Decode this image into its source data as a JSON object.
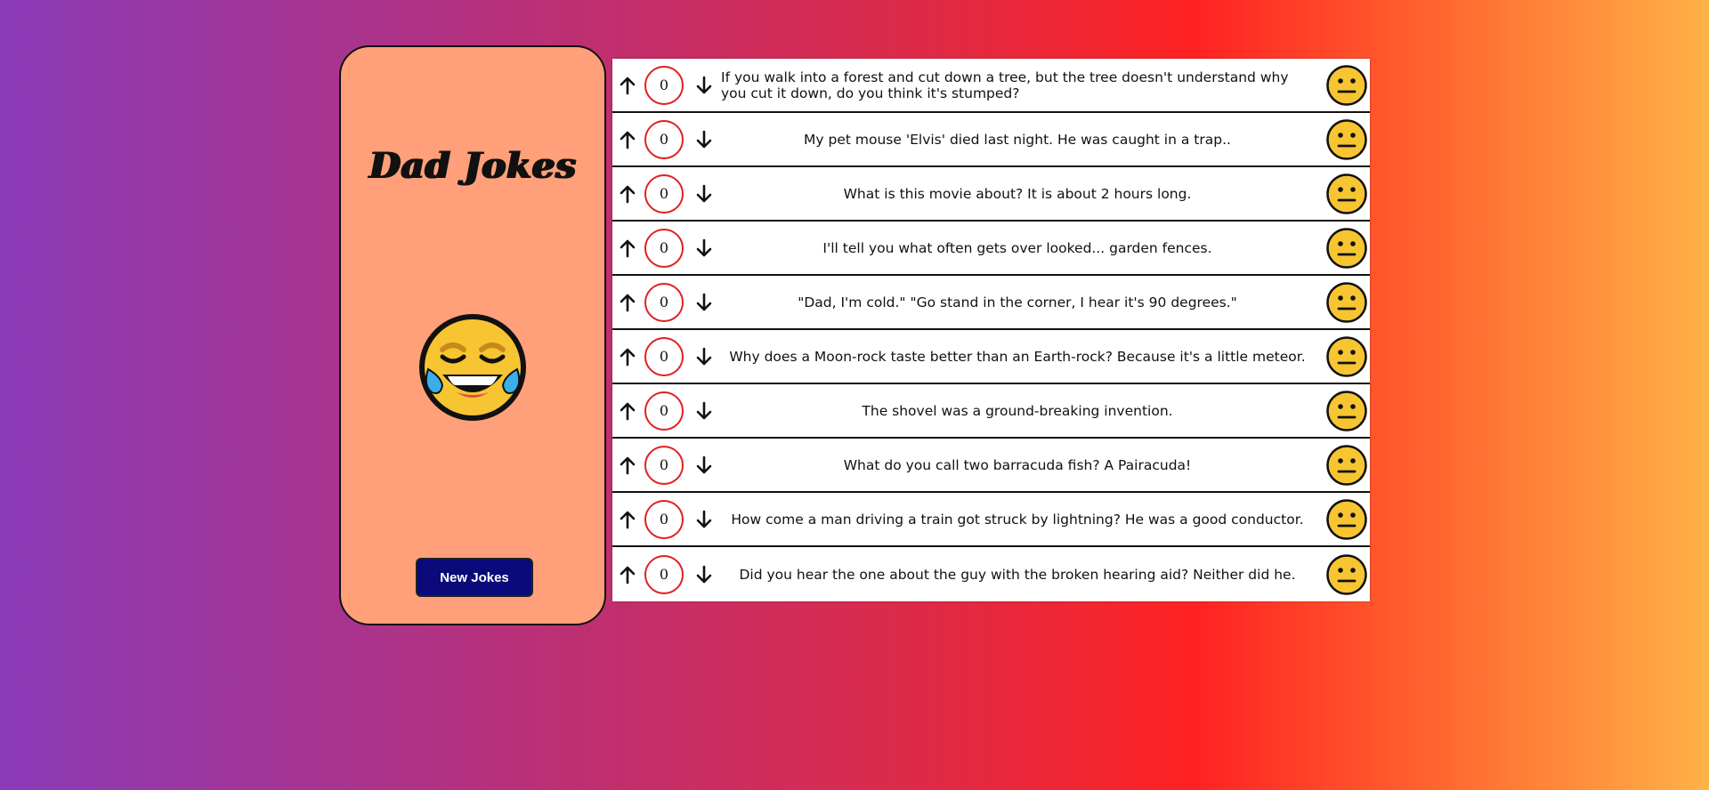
{
  "app": {
    "title": "Dad Jokes",
    "new_jokes_label": "New Jokes"
  },
  "icons": {
    "header_emoji": "laughing-tears-emoji-icon",
    "joke_emoji": "neutral-face-emoji-icon",
    "upvote": "arrow-up-icon",
    "downvote": "arrow-down-icon"
  },
  "colors": {
    "sidebar_bg": "#ffa07a",
    "button_bg": "#0a0a7a",
    "score_border": "#e02020"
  },
  "jokes": [
    {
      "score": "0",
      "text": "If you walk into a forest and cut down a tree, but the tree doesn't understand why you cut it down, do you think it's stumped?"
    },
    {
      "score": "0",
      "text": "My pet mouse 'Elvis' died last night. He was caught in a trap.."
    },
    {
      "score": "0",
      "text": "What is this movie about? It is about 2 hours long."
    },
    {
      "score": "0",
      "text": "I'll tell you what often gets over looked... garden fences."
    },
    {
      "score": "0",
      "text": "\"Dad, I'm cold.\" \"Go stand in the corner, I hear it's 90 degrees.\""
    },
    {
      "score": "0",
      "text": "Why does a Moon-rock taste better than an Earth-rock? Because it's a little meteor."
    },
    {
      "score": "0",
      "text": "The shovel was a ground-breaking invention."
    },
    {
      "score": "0",
      "text": "What do you call two barracuda fish? A Pairacuda!"
    },
    {
      "score": "0",
      "text": "How come a man driving a train got struck by lightning? He was a good conductor."
    },
    {
      "score": "0",
      "text": "Did you hear the one about the guy with the broken hearing aid? Neither did he."
    }
  ]
}
